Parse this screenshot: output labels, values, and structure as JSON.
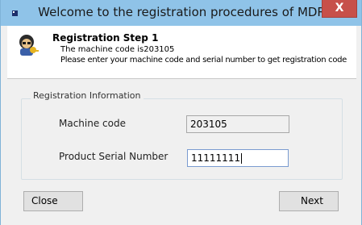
{
  "window": {
    "title": "Welcome to the registration procedures of MDR",
    "close_glyph": "X"
  },
  "header": {
    "step_title": "Registration Step 1",
    "line1": "The machine code is203105",
    "line2": "Please enter your machine code and serial number to get registration code"
  },
  "form": {
    "group_label": "Registration Information",
    "machine_code_label": "Machine code",
    "machine_code_value": "203105",
    "serial_label": "Product Serial Number",
    "serial_value": "11111111"
  },
  "buttons": {
    "close_label": "Close",
    "next_label": "Next"
  },
  "colors": {
    "titlebar": "#8fc3e8",
    "close_button": "#c7504a",
    "dialog_background": "#f0f0f0"
  },
  "icons": {
    "app_icon": "app-icon",
    "header_avatar": "registration-avatar-icon"
  }
}
